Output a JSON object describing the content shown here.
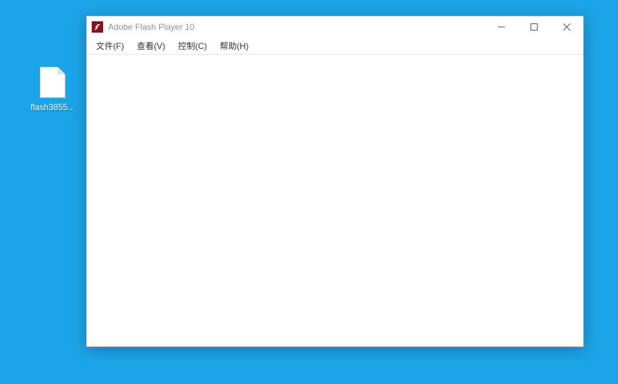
{
  "desktop": {
    "icons": [
      {
        "label": "flash3855..."
      }
    ]
  },
  "window": {
    "title": "Adobe Flash Player 10",
    "menu": [
      {
        "label": "文件(F)"
      },
      {
        "label": "查看(V)"
      },
      {
        "label": "控制(C)"
      },
      {
        "label": "帮助(H)"
      }
    ]
  }
}
